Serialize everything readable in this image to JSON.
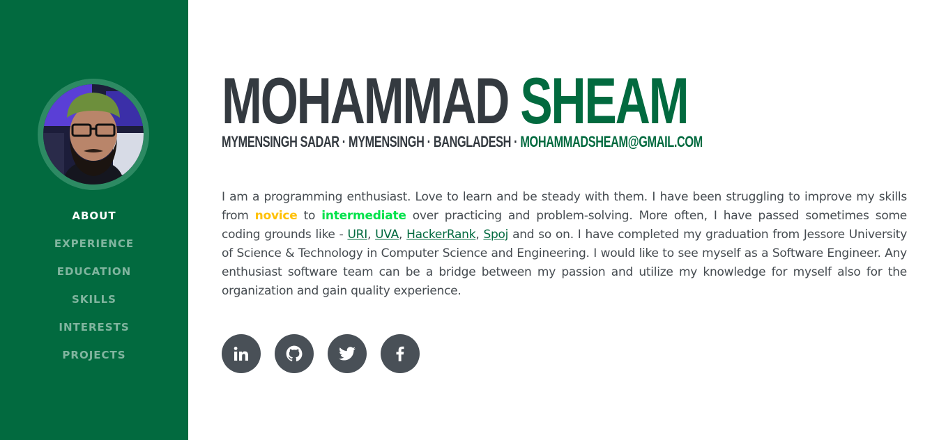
{
  "sidebar": {
    "nav": [
      {
        "label": "ABOUT",
        "active": true
      },
      {
        "label": "EXPERIENCE",
        "active": false
      },
      {
        "label": "EDUCATION",
        "active": false
      },
      {
        "label": "SKILLS",
        "active": false
      },
      {
        "label": "INTERESTS",
        "active": false
      },
      {
        "label": "PROJECTS",
        "active": false
      }
    ]
  },
  "profile": {
    "first_name": "MOHAMMAD",
    "last_name": "SHEAM",
    "location": "MYMENSINGH SADAR · MYMENSINGH · BANGLADESH ·",
    "email": "MOHAMMADSHEAM@GMAIL.COM"
  },
  "about": {
    "p1": "I am a programming enthusiast. Love to learn and be steady with them. I have been struggling to improve my skills from ",
    "novice": "novice",
    "to": " to ",
    "intermediate": "intermediate",
    "p2": " over practicing and problem-solving. More often, I have passed sometimes some coding grounds like - ",
    "link_uri": "URI",
    "sep1": ", ",
    "link_uva": "UVA",
    "sep2": ", ",
    "link_hackerrank": "HackerRank",
    "sep3": ", ",
    "link_spoj": "Spoj",
    "p3": " and so on. I have completed my graduation from Jessore University of Science & Technology in Computer Science and Engineering. I would like to see myself as a Software Engineer. Any enthusiast software team can be a bridge between my passion and utilize my knowledge for myself also for the organization and gain quality experience."
  },
  "social": [
    {
      "icon": "linkedin-icon"
    },
    {
      "icon": "github-icon"
    },
    {
      "icon": "twitter-icon"
    },
    {
      "icon": "facebook-icon"
    }
  ],
  "colors": {
    "primary": "#026a3f",
    "nav_inactive": "rgba(255,255,255,0.5)",
    "heading": "#343a40",
    "body_text": "#454b50",
    "novice": "#ffc107",
    "intermediate": "#00e24a",
    "social_bg": "#495057"
  }
}
